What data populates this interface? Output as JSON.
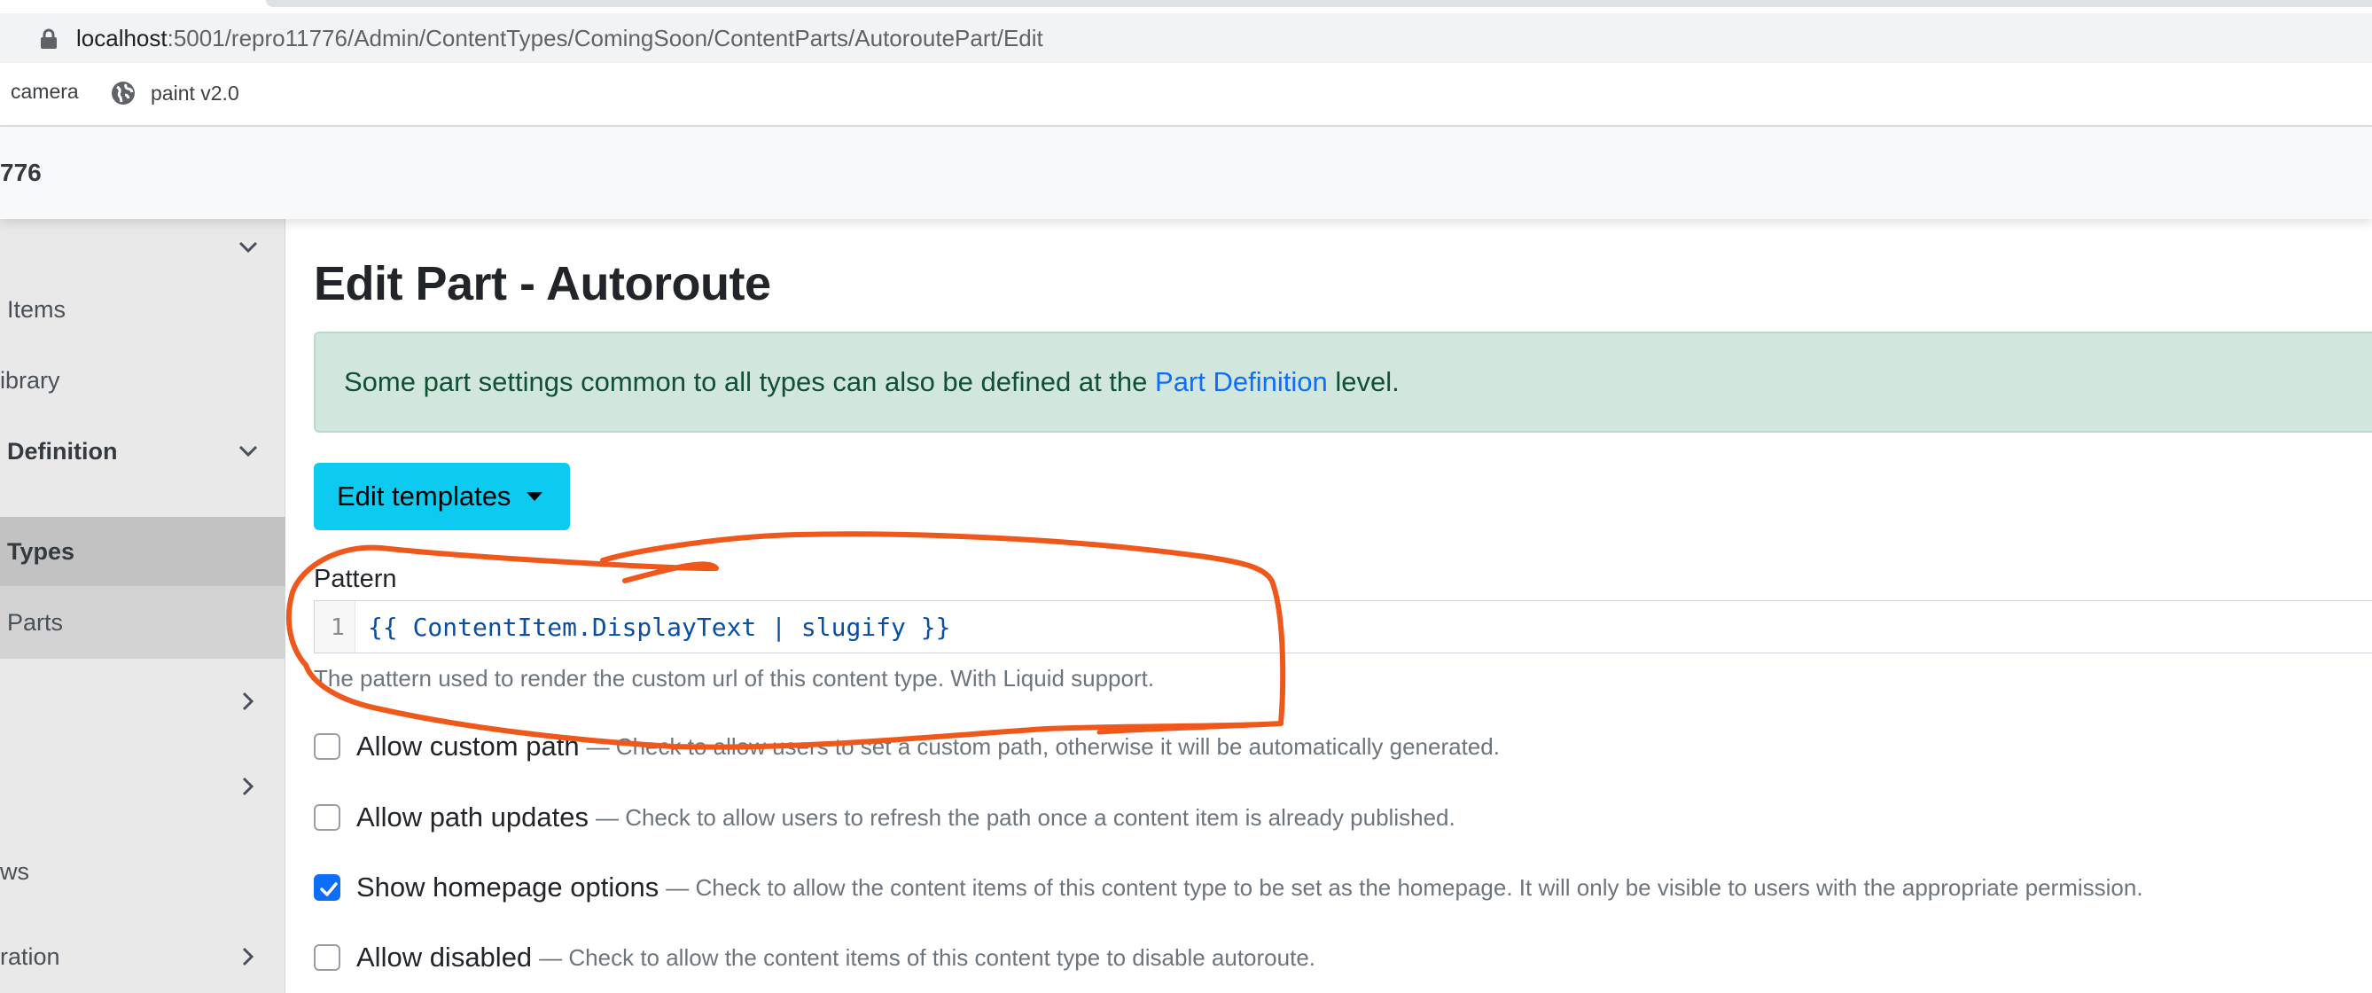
{
  "browser": {
    "url_host": "localhost",
    "url_rest": ":5001/repro11776/Admin/ContentTypes/ComingSoon/ContentParts/AutoroutePart/Edit",
    "bookmarks": [
      {
        "label": "camera",
        "icon": "none"
      },
      {
        "label": "paint v2.0",
        "icon": "globe-icon"
      }
    ]
  },
  "navbar": {
    "brand": "776"
  },
  "sidebar": {
    "items": [
      {
        "label": "",
        "chevron": "chevron-down-icon"
      },
      {
        "label": "Items"
      },
      {
        "label": "ibrary"
      },
      {
        "label": "Definition",
        "chevron": "chevron-down-icon"
      },
      {
        "label": "Types"
      },
      {
        "label": "Parts"
      },
      {
        "label": "",
        "chevron": "chevron-right-icon"
      },
      {
        "label": "",
        "chevron": "chevron-right-icon"
      },
      {
        "label": "ws"
      },
      {
        "label": "ration",
        "chevron": "chevron-right-icon"
      }
    ]
  },
  "main": {
    "title": "Edit Part - Autoroute",
    "alert": {
      "before": "Some part settings common to all types can also be defined at the ",
      "link": "Part Definition",
      "after": " level."
    },
    "edit_templates_label": "Edit templates",
    "pattern": {
      "label": "Pattern",
      "line_number": "1",
      "value": "{{ ContentItem.DisplayText | slugify }}",
      "help": "The pattern used to render the custom url of this content type. With Liquid support."
    },
    "options": [
      {
        "label": "Allow custom path",
        "desc": "— Check to allow users to set a custom path, otherwise it will be automatically generated.",
        "checked": false
      },
      {
        "label": "Allow path updates",
        "desc": "— Check to allow users to refresh the path once a content item is already published.",
        "checked": false
      },
      {
        "label": "Show homepage options",
        "desc": "— Check to allow the content items of this content type to be set as the homepage. It will only be visible to users with the appropriate permission.",
        "checked": true
      },
      {
        "label": "Allow disabled",
        "desc": "— Check to allow the content items of this content type to disable autoroute.",
        "checked": false
      }
    ]
  },
  "colors": {
    "accent": "#0dcaf0",
    "alert_bg": "#d1e7dd",
    "link": "#0d6efd",
    "annotation": "#f0571a"
  }
}
